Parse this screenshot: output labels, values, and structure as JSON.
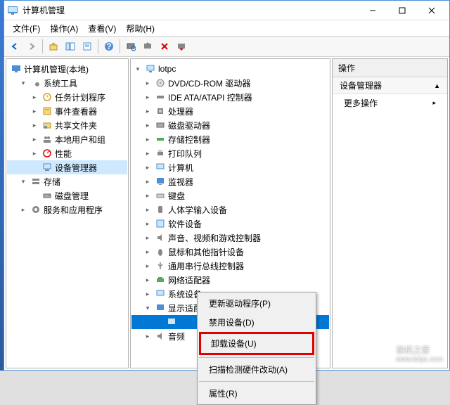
{
  "window": {
    "title": "计算机管理"
  },
  "menubar": {
    "file": "文件(F)",
    "action": "操作(A)",
    "view": "查看(V)",
    "help": "帮助(H)"
  },
  "left_tree": {
    "root": "计算机管理(本地)",
    "system_tools": "系统工具",
    "task_scheduler": "任务计划程序",
    "event_viewer": "事件查看器",
    "shared_folders": "共享文件夹",
    "local_users": "本地用户和组",
    "performance": "性能",
    "device_manager": "设备管理器",
    "storage": "存储",
    "disk_management": "磁盘管理",
    "services_apps": "服务和应用程序"
  },
  "mid_tree": {
    "root": "lotpc",
    "dvd": "DVD/CD-ROM 驱动器",
    "ide": "IDE ATA/ATAPI 控制器",
    "cpu": "处理器",
    "disk_drives": "磁盘驱动器",
    "storage_ctrl": "存储控制器",
    "print_queues": "打印队列",
    "computer": "计算机",
    "monitor": "监视器",
    "keyboard": "键盘",
    "hid": "人体学输入设备",
    "software_dev": "软件设备",
    "sound": "声音、视频和游戏控制器",
    "mouse": "鼠标和其他指针设备",
    "usb": "通用串行总线控制器",
    "network": "网络适配器",
    "system_dev": "系统设备",
    "display_adapters": "显示适配器",
    "audio_io": "音频"
  },
  "right_panel": {
    "header": "操作",
    "section": "设备管理器",
    "more_actions": "更多操作"
  },
  "context_menu": {
    "update_driver": "更新驱动程序(P)",
    "disable": "禁用设备(D)",
    "uninstall": "卸载设备(U)",
    "scan_hw": "扫描检测硬件改动(A)",
    "properties": "属性(R)"
  },
  "watermark": {
    "text": "装机之家",
    "url": "www.lotpc.com"
  }
}
